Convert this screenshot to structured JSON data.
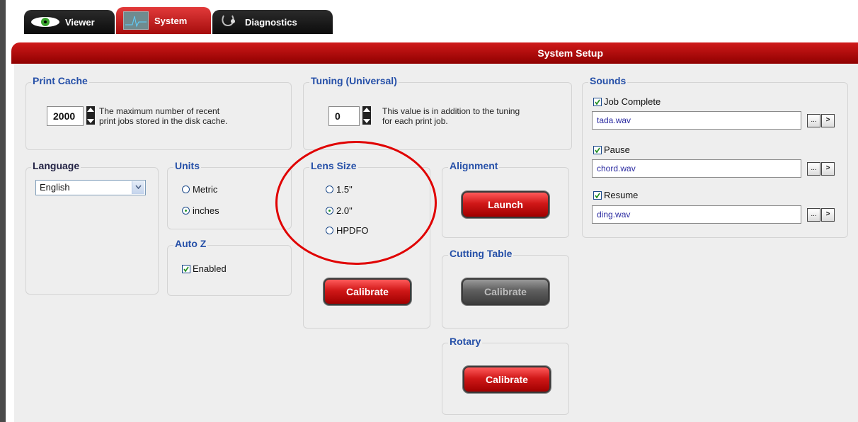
{
  "tabs": [
    {
      "label": "Viewer",
      "icon": "eye-icon",
      "active": false
    },
    {
      "label": "System",
      "icon": "graph-icon",
      "active": true
    },
    {
      "label": "Diagnostics",
      "icon": "stethoscope-icon",
      "active": false
    }
  ],
  "header": {
    "title": "System Setup"
  },
  "print_cache": {
    "title": "Print Cache",
    "value": "2000",
    "description_line1": "The maximum number of recent",
    "description_line2": "print jobs stored in the disk cache."
  },
  "tuning": {
    "title": "Tuning (Universal)",
    "value": "0",
    "description_line1": "This value is in addition to the tuning",
    "description_line2": "for each print job."
  },
  "language": {
    "title": "Language",
    "selected": "English"
  },
  "units": {
    "title": "Units",
    "options": [
      "Metric",
      "inches"
    ],
    "selected": "inches"
  },
  "auto_z": {
    "title": "Auto Z",
    "checkbox_label": "Enabled",
    "checked": true
  },
  "lens_size": {
    "title": "Lens Size",
    "options": [
      "1.5\"",
      "2.0\"",
      "HPDFO"
    ],
    "selected": "2.0\"",
    "button_label": "Calibrate"
  },
  "alignment": {
    "title": "Alignment",
    "button_label": "Launch"
  },
  "cutting_table": {
    "title": "Cutting Table",
    "button_label": "Calibrate",
    "enabled": false
  },
  "rotary": {
    "title": "Rotary",
    "button_label": "Calibrate"
  },
  "sounds": {
    "title": "Sounds",
    "items": [
      {
        "label": "Job Complete",
        "checked": true,
        "file": "tada.wav"
      },
      {
        "label": "Pause",
        "checked": true,
        "file": "chord.wav"
      },
      {
        "label": "Resume",
        "checked": true,
        "file": "ding.wav"
      }
    ],
    "browse_label": "...",
    "play_label": ">"
  },
  "colors": {
    "accent_red": "#c00000",
    "title_blue": "#2650a8",
    "highlight": "#e00000"
  }
}
